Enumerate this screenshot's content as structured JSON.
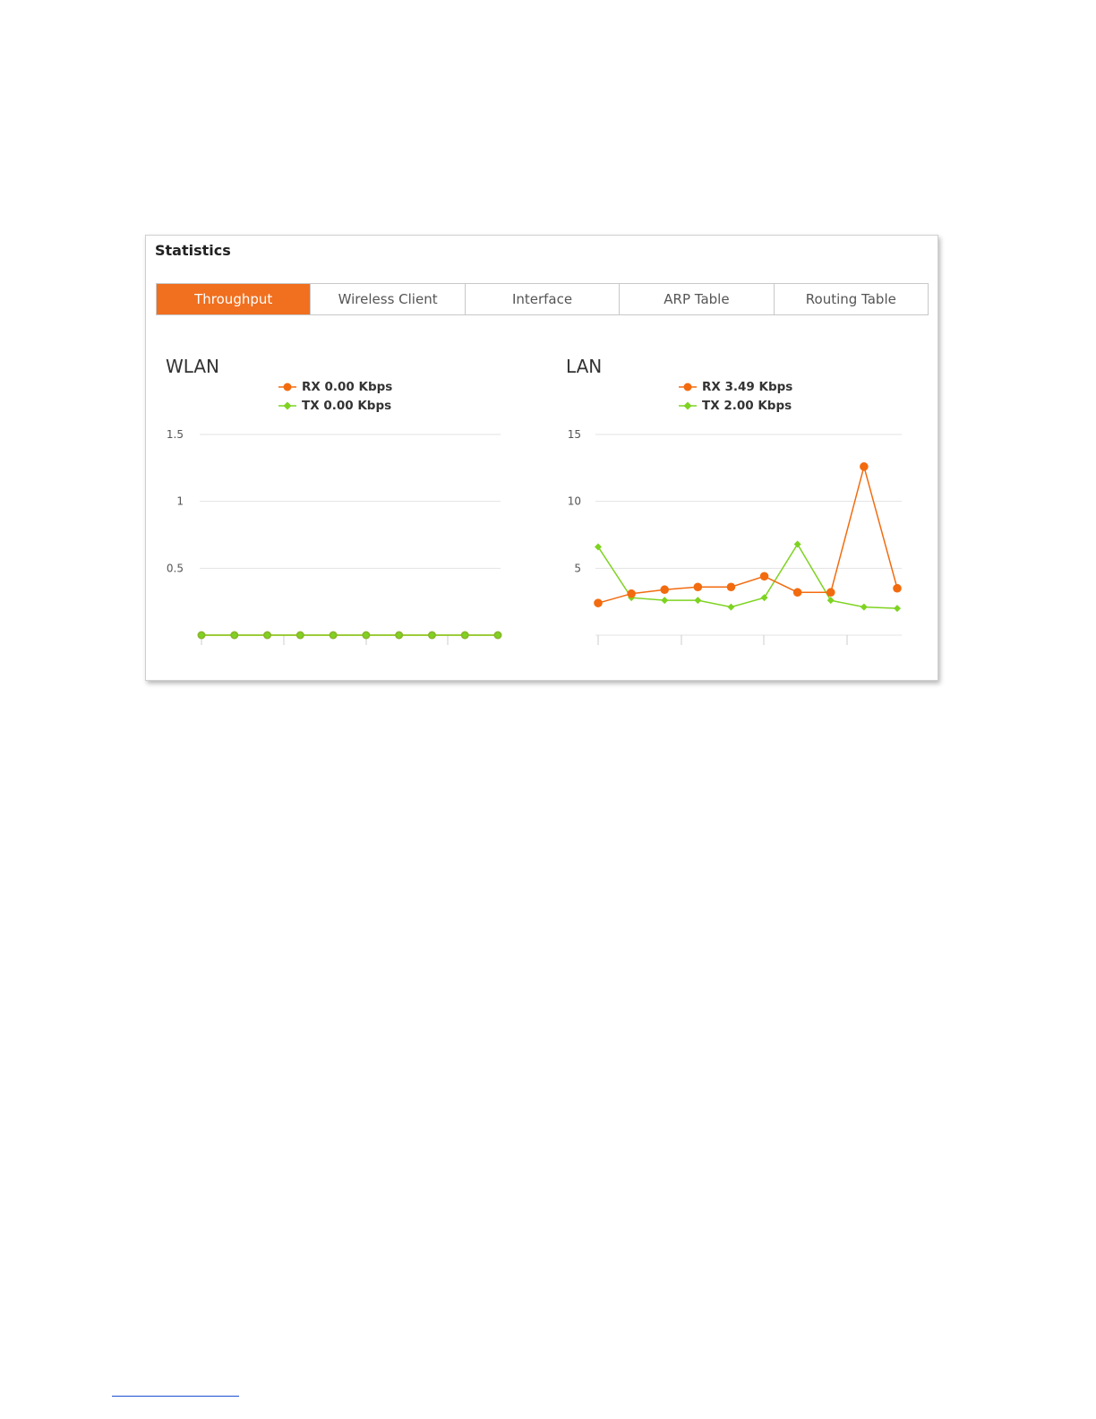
{
  "panel": {
    "title": "Statistics"
  },
  "tabs": [
    {
      "label": "Throughput",
      "active": true
    },
    {
      "label": "Wireless Client",
      "active": false
    },
    {
      "label": "Interface",
      "active": false
    },
    {
      "label": "ARP Table",
      "active": false
    },
    {
      "label": "Routing Table",
      "active": false
    }
  ],
  "colors": {
    "accent": "#f07020",
    "rx": "#f26b0f",
    "tx": "#7ed321",
    "grid": "#e3e3e3",
    "link": "#1a4fd6"
  },
  "chart_data": [
    {
      "type": "line",
      "title": "WLAN",
      "ylim": [
        0,
        1.5
      ],
      "yticks": [
        0.5,
        1,
        1.5
      ],
      "ytick_labels": [
        "0.5",
        "1",
        "1.5"
      ],
      "grid": true,
      "legend_placement": "top-center",
      "series": [
        {
          "name": "RX 0.00 Kbps",
          "marker": "circle",
          "values": [
            0,
            0,
            0,
            0,
            0,
            0,
            0,
            0,
            0,
            0
          ]
        },
        {
          "name": "TX 0.00 Kbps",
          "marker": "diamond",
          "values": [
            0,
            0,
            0,
            0,
            0,
            0,
            0,
            0,
            0,
            0
          ]
        }
      ]
    },
    {
      "type": "line",
      "title": "LAN",
      "ylim": [
        0,
        15
      ],
      "yticks": [
        5,
        10,
        15
      ],
      "ytick_labels": [
        "5",
        "10",
        "15"
      ],
      "grid": true,
      "legend_placement": "top-center",
      "series": [
        {
          "name": "RX 3.49 Kbps",
          "marker": "circle",
          "values": [
            2.4,
            3.1,
            3.4,
            3.6,
            3.6,
            4.4,
            3.2,
            3.2,
            12.6,
            3.5
          ]
        },
        {
          "name": "TX 2.00 Kbps",
          "marker": "diamond",
          "values": [
            6.6,
            2.8,
            2.6,
            2.6,
            2.1,
            2.8,
            6.8,
            2.6,
            2.1,
            2.0
          ]
        }
      ]
    }
  ]
}
